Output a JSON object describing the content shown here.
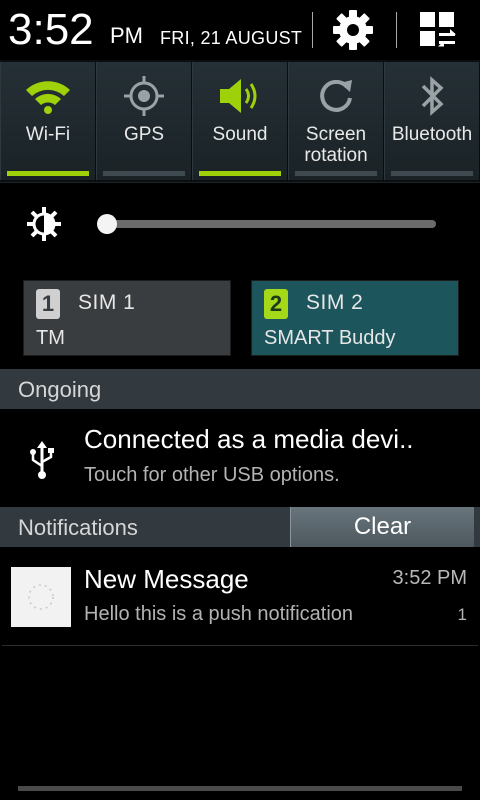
{
  "header": {
    "time": "3:52",
    "ampm": "PM",
    "date": "FRI, 21 AUGUST",
    "settings_icon": "gear-icon",
    "edit_icon": "grid-edit-icon"
  },
  "toggles": [
    {
      "label": "Wi-Fi",
      "icon": "wifi-icon",
      "on": true
    },
    {
      "label": "GPS",
      "icon": "gps-icon",
      "on": false
    },
    {
      "label": "Sound",
      "icon": "sound-icon",
      "on": true
    },
    {
      "label": "Screen\nrotation",
      "icon": "rotation-icon",
      "on": false
    },
    {
      "label": "Bluetooth",
      "icon": "bluetooth-icon",
      "on": false
    }
  ],
  "brightness": {
    "icon": "brightness-icon",
    "level": 0.0
  },
  "sims": [
    {
      "badge": "1",
      "name": "SIM 1",
      "carrier": "TM"
    },
    {
      "badge": "2",
      "name": "SIM 2",
      "carrier": "SMART Buddy"
    }
  ],
  "ongoing": {
    "header": "Ongoing",
    "title": "Connected as a media devi..",
    "subtitle": "Touch for other USB options.",
    "icon": "usb-icon"
  },
  "notifications": {
    "header": "Notifications",
    "clear_label": "Clear",
    "items": [
      {
        "title": "New Message",
        "time": "3:52 PM",
        "text": "Hello this is a push notification",
        "count": "1",
        "icon": "app-icon"
      }
    ]
  },
  "colors": {
    "accent_green": "#9ed10a",
    "sim2_background": "#1c555c",
    "section_background": "#333a3f"
  }
}
